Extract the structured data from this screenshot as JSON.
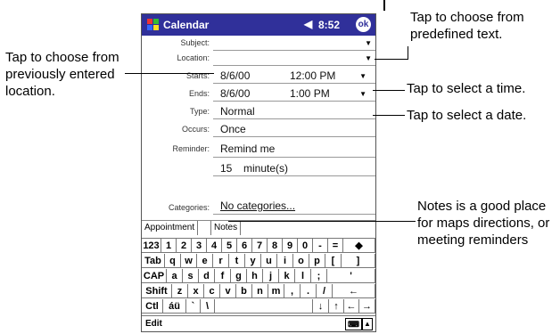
{
  "app": {
    "title": "Calendar",
    "time": "8:52",
    "ok_label": "ok"
  },
  "fields": {
    "subject": {
      "label": "Subject:",
      "value": ""
    },
    "location": {
      "label": "Location:",
      "value": ""
    },
    "starts": {
      "label": "Starts:",
      "date": "8/6/00",
      "time": "12:00 PM"
    },
    "ends": {
      "label": "Ends:",
      "date": "8/6/00",
      "time": "1:00 PM"
    },
    "type": {
      "label": "Type:",
      "value": "Normal"
    },
    "occurs": {
      "label": "Occurs:",
      "value": "Once"
    },
    "reminder": {
      "label": "Reminder:",
      "value": "Remind me",
      "amount": "15",
      "unit": "minute(s)"
    },
    "categories": {
      "label": "Categories:",
      "value": "No categories..."
    }
  },
  "tabs": [
    "Appointment",
    "Notes"
  ],
  "keyboard": {
    "row1": [
      "123",
      "1",
      "2",
      "3",
      "4",
      "5",
      "6",
      "7",
      "8",
      "9",
      "0",
      "-",
      "=",
      "◆"
    ],
    "row2": [
      "Tab",
      "q",
      "w",
      "e",
      "r",
      "t",
      "y",
      "u",
      "i",
      "o",
      "p",
      "[",
      "]"
    ],
    "row3": [
      "CAP",
      "a",
      "s",
      "d",
      "f",
      "g",
      "h",
      "j",
      "k",
      "l",
      ";",
      "'"
    ],
    "row4": [
      "Shift",
      "z",
      "x",
      "c",
      "v",
      "b",
      "n",
      "m",
      ",",
      ".",
      "/",
      "←"
    ],
    "row5": [
      "Ctl",
      "áü",
      "`",
      "\\",
      "↓",
      "↑",
      "←",
      "→"
    ]
  },
  "command_bar": {
    "edit": "Edit"
  },
  "annotations": {
    "predefined": "Tap to choose from predefined text.",
    "previous_location": "Tap to choose from previously entered location.",
    "select_time": "Tap to select a time.",
    "select_date": "Tap to select a date.",
    "notes": "Notes is a good place for maps directions, or meeting reminders"
  }
}
